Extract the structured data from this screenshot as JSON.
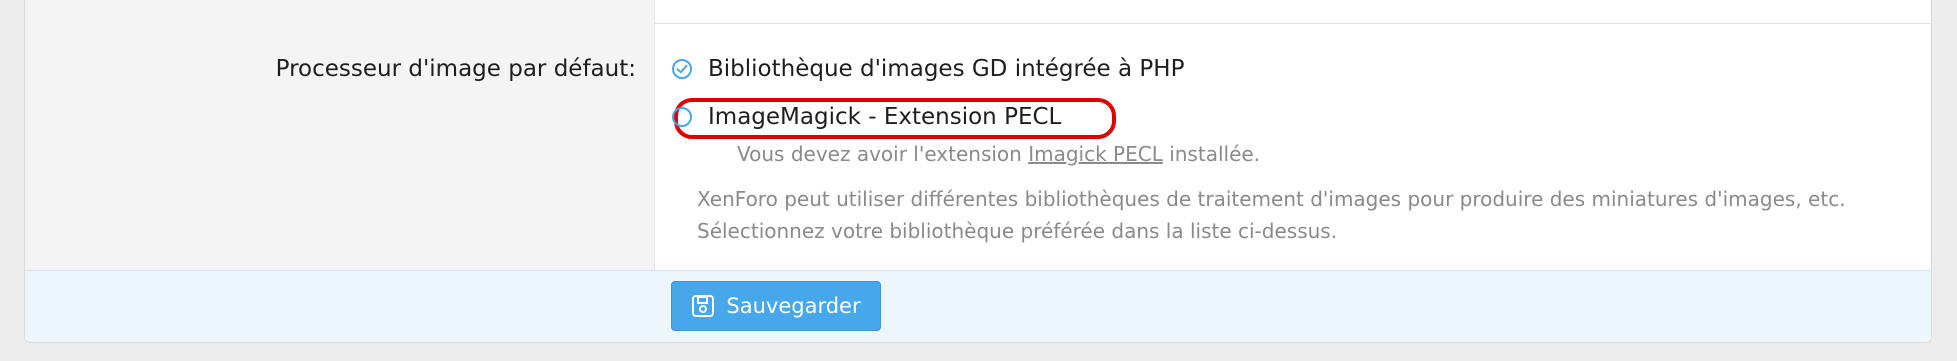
{
  "form": {
    "label": "Processeur d'image par défaut:",
    "options": [
      {
        "label": "Bibliothèque d'images GD intégrée à PHP",
        "selected": true,
        "icon": "check-circle-icon"
      },
      {
        "label": "ImageMagick - Extension PECL",
        "selected": false,
        "icon": "radio-empty-icon"
      }
    ],
    "hint_prefix": "Vous devez avoir l'extension ",
    "hint_link": "Imagick PECL",
    "hint_suffix": " installée.",
    "explain_line1": "XenForo peut utiliser différentes bibliothèques de traitement d'images pour produire des miniatures d'images, etc.",
    "explain_line2": "Sélectionnez votre bibliothèque préférée dans la liste ci-dessus."
  },
  "footer": {
    "save_label": "Sauvegarder",
    "save_icon": "floppy-disk-icon"
  },
  "colors": {
    "accent": "#47a7eb",
    "highlight": "#e00000"
  }
}
